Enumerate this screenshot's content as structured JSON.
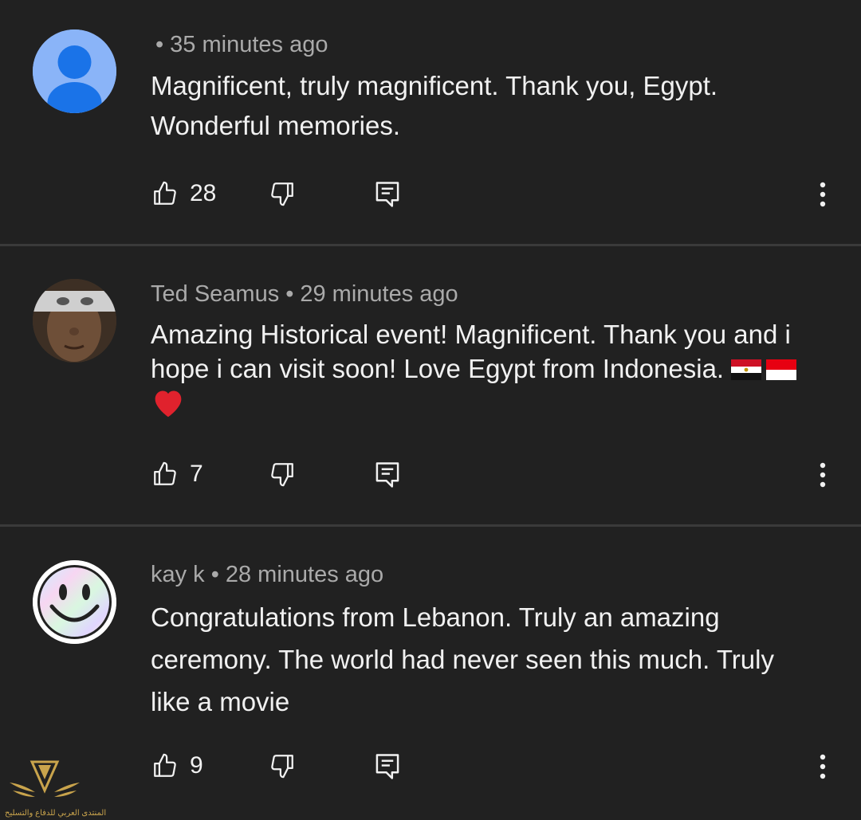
{
  "comments": [
    {
      "author": "",
      "time": "35 minutes ago",
      "text": "Magnificent, truly magnificent. Thank you, Egypt. Wonderful memories.",
      "likes": "28",
      "avatar": "default-person-avatar"
    },
    {
      "author": "Ted Seamus",
      "time": "29 minutes ago",
      "text": "Amazing Historical event! Magnificent. Thank you and i hope i can visit soon! Love Egypt from Indonesia.",
      "emoji": [
        "egypt-flag",
        "indonesia-flag",
        "red-heart"
      ],
      "likes": "7",
      "avatar": "photo-avatar"
    },
    {
      "author": "kay k",
      "time": "28 minutes ago",
      "text": "Congratulations from Lebanon. Truly an amazing ceremony. The world had never seen this much. Truly like a movie",
      "likes": "9",
      "avatar": "smiley-avatar"
    }
  ],
  "icons": {
    "like": "thumb-up-icon",
    "dislike": "thumb-down-icon",
    "reply": "reply-comment-icon",
    "menu": "more-vert-icon"
  },
  "colors": {
    "background": "#212121",
    "divider": "#3a3a3a",
    "text_primary": "#f1f1f1",
    "text_secondary": "#aaaaaa",
    "default_avatar": "#8ab4f8"
  },
  "watermark": {
    "text": "المنتدى العربي للدفاع والتسليح"
  }
}
